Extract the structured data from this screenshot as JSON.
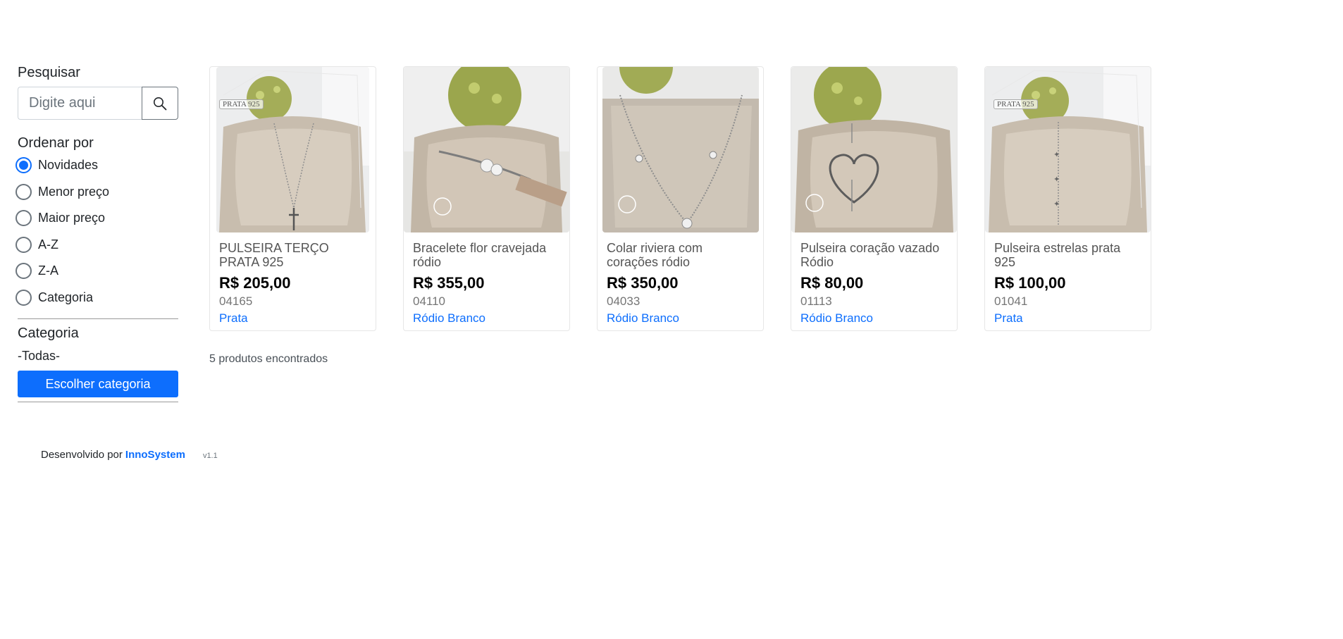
{
  "sidebar": {
    "search_label": "Pesquisar",
    "search_placeholder": "Digite aqui",
    "sort_label": "Ordenar por",
    "sort_options": [
      {
        "label": "Novidades",
        "checked": true
      },
      {
        "label": "Menor preço",
        "checked": false
      },
      {
        "label": "Maior preço",
        "checked": false
      },
      {
        "label": "A-Z",
        "checked": false
      },
      {
        "label": "Z-A",
        "checked": false
      },
      {
        "label": "Categoria",
        "checked": false
      }
    ],
    "category_label": "Categoria",
    "category_value": "-Todas-",
    "category_button": "Escolher categoria"
  },
  "products": [
    {
      "name": "PULSEIRA TERÇO PRATA 925",
      "price": "R$ 205,00",
      "code": "04165",
      "category": "Prata",
      "watermark": "PRATA 925"
    },
    {
      "name": "Bracelete flor cravejada ródio",
      "price": "R$ 355,00",
      "code": "04110",
      "category": "Ródio Branco"
    },
    {
      "name": "Colar riviera com corações ródio",
      "price": "R$ 350,00",
      "code": "04033",
      "category": "Ródio Branco"
    },
    {
      "name": "Pulseira coração vazado Ródio",
      "price": "R$ 80,00",
      "code": "01113",
      "category": "Ródio Branco"
    },
    {
      "name": "Pulseira estrelas prata 925",
      "price": "R$ 100,00",
      "code": "01041",
      "category": "Prata",
      "watermark": "PRATA 925"
    }
  ],
  "results_count": "5 produtos encontrados",
  "footer": {
    "developed_by": "Desenvolvido por",
    "brand": "InnoSystem",
    "version": "v1.1"
  },
  "colors": {
    "accent": "#0d6efd"
  }
}
